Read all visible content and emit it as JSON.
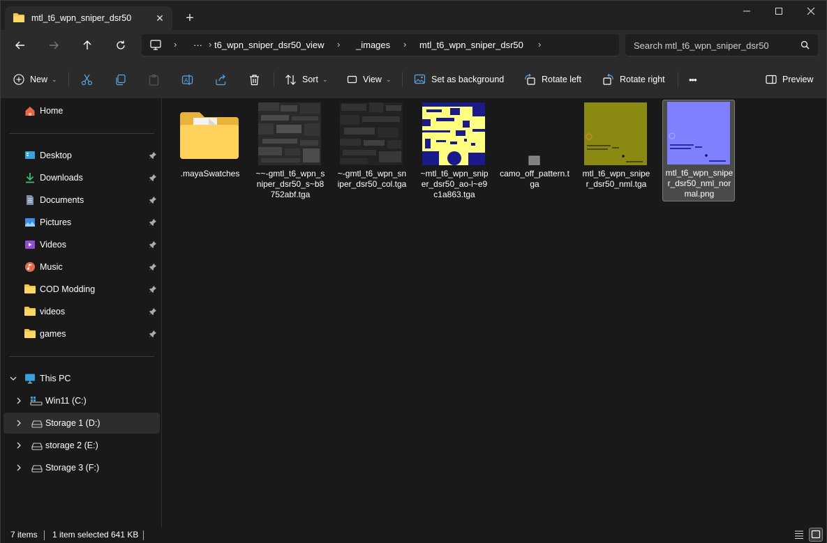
{
  "window": {
    "tab_title": "mtl_t6_wpn_sniper_dsr50",
    "tab_close": "✕",
    "new_tab": "+",
    "controls": {
      "minimize": "—",
      "maximize": "☐",
      "close": "✕"
    }
  },
  "address": {
    "overflow": "···",
    "crumbs": [
      "t6_wpn_sniper_dsr50_view",
      "_images",
      "mtl_t6_wpn_sniper_dsr50"
    ],
    "search_placeholder": "Search mtl_t6_wpn_sniper_dsr50"
  },
  "toolbar": {
    "new_label": "New",
    "sort_label": "Sort",
    "view_label": "View",
    "set_bg_label": "Set as background",
    "rotate_left_label": "Rotate left",
    "rotate_right_label": "Rotate right",
    "more_label": "•••",
    "preview_label": "Preview"
  },
  "sidebar": {
    "home": "Home",
    "quick_access": [
      {
        "label": "Desktop",
        "icon": "desktop-icon"
      },
      {
        "label": "Downloads",
        "icon": "download-icon"
      },
      {
        "label": "Documents",
        "icon": "document-icon"
      },
      {
        "label": "Pictures",
        "icon": "pictures-icon"
      },
      {
        "label": "Videos",
        "icon": "videos-icon"
      },
      {
        "label": "Music",
        "icon": "music-icon"
      },
      {
        "label": "COD Modding",
        "icon": "folder-icon"
      },
      {
        "label": "videos",
        "icon": "folder-icon"
      },
      {
        "label": "games",
        "icon": "folder-icon"
      }
    ],
    "this_pc": "This PC",
    "drives": [
      "Win11 (C:)",
      "Storage 1 (D:)",
      "storage 2 (E:)",
      "Storage 3 (F:)"
    ],
    "selected_drive_index": 1
  },
  "files": [
    {
      "name": ".mayaSwatches",
      "kind": "folder"
    },
    {
      "name": "~~-gmtl_t6_wpn_sniper_dsr50_s~b8752abf.tga",
      "kind": "dark-texture"
    },
    {
      "name": "~-gmtl_t6_wpn_sniper_dsr50_col.tga",
      "kind": "dark-texture"
    },
    {
      "name": "~mtl_t6_wpn_sniper_dsr50_ao-l~e9c1a863.tga",
      "kind": "yellow-ao"
    },
    {
      "name": "camo_off_pattern.tga",
      "kind": "small-grey"
    },
    {
      "name": "mtl_t6_wpn_sniper_dsr50_nml.tga",
      "kind": "olive-normal"
    },
    {
      "name": "mtl_t6_wpn_sniper_dsr50_nml_normal.png",
      "kind": "blue-normal"
    }
  ],
  "selected_file_index": 6,
  "status": {
    "items": "7 items",
    "selected": "1 item selected",
    "size": "641 KB"
  },
  "colors": {
    "background": "#191919",
    "toolbar": "#2b2b2b",
    "folder_yellow": "#f4c542",
    "ao_yellow": "#ffff80",
    "ao_blue": "#1a1a8a",
    "olive": "#8a8a1a",
    "normal_blue": "#8080ff"
  }
}
